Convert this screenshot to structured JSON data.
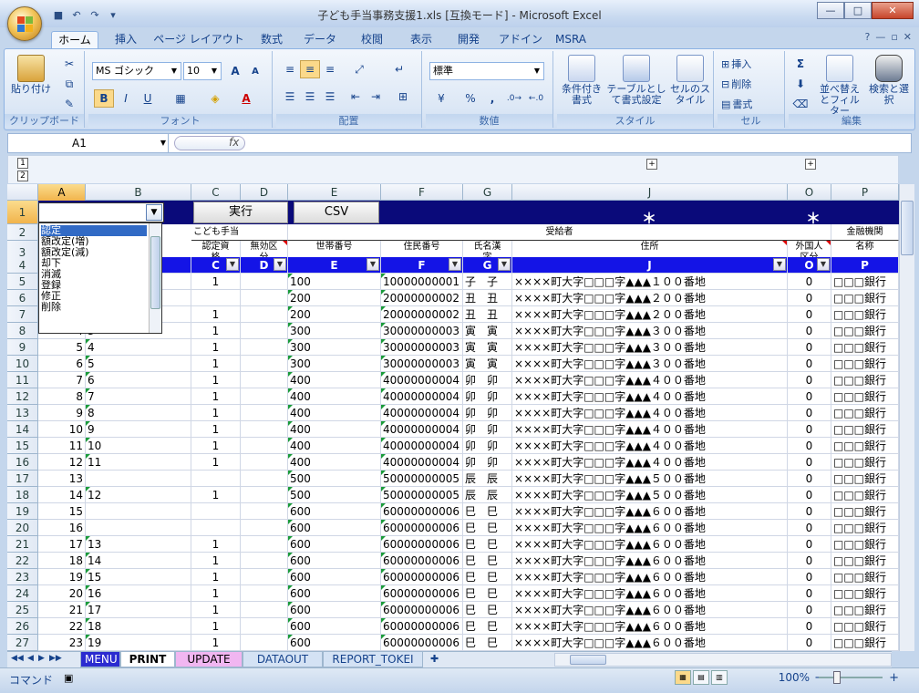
{
  "window": {
    "title": "子ども手当事務支援1.xls  [互換モード] - Microsoft Excel",
    "controls": {
      "minimize": "—",
      "maximize": "□",
      "close": "✕"
    }
  },
  "ribbon_tabs": [
    "ホーム",
    "挿入",
    "ページ レイアウト",
    "数式",
    "データ",
    "校閲",
    "表示",
    "開発",
    "アドイン",
    "MSRA"
  ],
  "ribbon_right": {
    "help": "?",
    "min": "—",
    "restore": "▫",
    "close": "✕"
  },
  "clipboard": {
    "paste": "貼り付け",
    "label": "クリップボード"
  },
  "font": {
    "name": "MS ゴシック",
    "size": "10",
    "label": "フォント",
    "grow": "A",
    "shrink": "A",
    "bold": "B",
    "italic": "I",
    "underline": "U",
    "font_color": "A"
  },
  "alignment": {
    "label": "配置"
  },
  "number": {
    "format": "標準",
    "label": "数値",
    "percent": "%",
    "comma": ","
  },
  "styles": {
    "conditional": "条件付き書式",
    "table": "テーブルとして書式設定",
    "cell": "セルのスタイル",
    "label": "スタイル"
  },
  "cells": {
    "insert": "挿入",
    "delete": "削除",
    "format": "書式",
    "label": "セル"
  },
  "editing": {
    "sum": "Σ",
    "sort": "並べ替えとフィルター",
    "find": "検索と選択",
    "label": "編集"
  },
  "formula_bar": {
    "name": "A1",
    "fx": "fx",
    "value": ""
  },
  "outline": {
    "level1": "1",
    "level2": "2",
    "plus": "+"
  },
  "columns": [
    "A",
    "B",
    "C",
    "D",
    "E",
    "F",
    "G",
    "J",
    "O",
    "P"
  ],
  "row1": {
    "exec_button": "実行",
    "csv_button": "CSV",
    "star": "＊"
  },
  "row2": {
    "child_allowance": "こども手当",
    "recipient": "受給者",
    "bank": "金融機関"
  },
  "row3": {
    "c": "認定資格",
    "d": "無効区分",
    "e": "世帯番号",
    "f": "住民番号",
    "g": "氏名漢字",
    "j": "住所",
    "o": "外国人区分",
    "p": "名称"
  },
  "row4": [
    "C",
    "D",
    "E",
    "F",
    "G",
    "J",
    "O",
    "P"
  ],
  "filter_arrow": "▼",
  "dropdown": {
    "arrow": "▼",
    "items": [
      "認定",
      "額改定(増)",
      "額改定(減)",
      "却下",
      "消滅",
      "登録",
      "修正",
      "削除"
    ]
  },
  "rows": [
    {
      "n": "5",
      "a": "",
      "b": "",
      "c": "1",
      "e": "100",
      "f": "10000000001",
      "g": "子　子",
      "j": "××××町大字□□□字▲▲▲１００番地",
      "o": "0",
      "p": "□□□銀行"
    },
    {
      "n": "6",
      "a": "",
      "b": "",
      "c": "",
      "e": "200",
      "f": "20000000002",
      "g": "丑　丑",
      "j": "××××町大字□□□字▲▲▲２００番地",
      "o": "0",
      "p": "□□□銀行"
    },
    {
      "n": "7",
      "a": "",
      "b": "",
      "c": "1",
      "e": "200",
      "f": "20000000002",
      "g": "丑　丑",
      "j": "××××町大字□□□字▲▲▲２００番地",
      "o": "0",
      "p": "□□□銀行"
    },
    {
      "n": "8",
      "a": "4",
      "b": "3",
      "c": "1",
      "e": "300",
      "f": "30000000003",
      "g": "寅　寅",
      "j": "××××町大字□□□字▲▲▲３００番地",
      "o": "0",
      "p": "□□□銀行"
    },
    {
      "n": "9",
      "a": "5",
      "b": "4",
      "c": "1",
      "e": "300",
      "f": "30000000003",
      "g": "寅　寅",
      "j": "××××町大字□□□字▲▲▲３００番地",
      "o": "0",
      "p": "□□□銀行"
    },
    {
      "n": "10",
      "a": "6",
      "b": "5",
      "c": "1",
      "e": "300",
      "f": "30000000003",
      "g": "寅　寅",
      "j": "××××町大字□□□字▲▲▲３００番地",
      "o": "0",
      "p": "□□□銀行"
    },
    {
      "n": "11",
      "a": "7",
      "b": "6",
      "c": "1",
      "e": "400",
      "f": "40000000004",
      "g": "卯　卯",
      "j": "××××町大字□□□字▲▲▲４００番地",
      "o": "0",
      "p": "□□□銀行"
    },
    {
      "n": "12",
      "a": "8",
      "b": "7",
      "c": "1",
      "e": "400",
      "f": "40000000004",
      "g": "卯　卯",
      "j": "××××町大字□□□字▲▲▲４００番地",
      "o": "0",
      "p": "□□□銀行"
    },
    {
      "n": "13",
      "a": "9",
      "b": "8",
      "c": "1",
      "e": "400",
      "f": "40000000004",
      "g": "卯　卯",
      "j": "××××町大字□□□字▲▲▲４００番地",
      "o": "0",
      "p": "□□□銀行"
    },
    {
      "n": "14",
      "a": "10",
      "b": "9",
      "c": "1",
      "e": "400",
      "f": "40000000004",
      "g": "卯　卯",
      "j": "××××町大字□□□字▲▲▲４００番地",
      "o": "0",
      "p": "□□□銀行"
    },
    {
      "n": "15",
      "a": "11",
      "b": "10",
      "c": "1",
      "e": "400",
      "f": "40000000004",
      "g": "卯　卯",
      "j": "××××町大字□□□字▲▲▲４００番地",
      "o": "0",
      "p": "□□□銀行"
    },
    {
      "n": "16",
      "a": "12",
      "b": "11",
      "c": "1",
      "e": "400",
      "f": "40000000004",
      "g": "卯　卯",
      "j": "××××町大字□□□字▲▲▲４００番地",
      "o": "0",
      "p": "□□□銀行"
    },
    {
      "n": "17",
      "a": "13",
      "b": "",
      "c": "",
      "e": "500",
      "f": "50000000005",
      "g": "辰　辰",
      "j": "××××町大字□□□字▲▲▲５００番地",
      "o": "0",
      "p": "□□□銀行"
    },
    {
      "n": "18",
      "a": "14",
      "b": "12",
      "c": "1",
      "e": "500",
      "f": "50000000005",
      "g": "辰　辰",
      "j": "××××町大字□□□字▲▲▲５００番地",
      "o": "0",
      "p": "□□□銀行"
    },
    {
      "n": "19",
      "a": "15",
      "b": "",
      "c": "",
      "e": "600",
      "f": "60000000006",
      "g": "巳　巳",
      "j": "××××町大字□□□字▲▲▲６００番地",
      "o": "0",
      "p": "□□□銀行"
    },
    {
      "n": "20",
      "a": "16",
      "b": "",
      "c": "",
      "e": "600",
      "f": "60000000006",
      "g": "巳　巳",
      "j": "××××町大字□□□字▲▲▲６００番地",
      "o": "0",
      "p": "□□□銀行"
    },
    {
      "n": "21",
      "a": "17",
      "b": "13",
      "c": "1",
      "e": "600",
      "f": "60000000006",
      "g": "巳　巳",
      "j": "××××町大字□□□字▲▲▲６００番地",
      "o": "0",
      "p": "□□□銀行"
    },
    {
      "n": "22",
      "a": "18",
      "b": "14",
      "c": "1",
      "e": "600",
      "f": "60000000006",
      "g": "巳　巳",
      "j": "××××町大字□□□字▲▲▲６００番地",
      "o": "0",
      "p": "□□□銀行"
    },
    {
      "n": "23",
      "a": "19",
      "b": "15",
      "c": "1",
      "e": "600",
      "f": "60000000006",
      "g": "巳　巳",
      "j": "××××町大字□□□字▲▲▲６００番地",
      "o": "0",
      "p": "□□□銀行"
    },
    {
      "n": "24",
      "a": "20",
      "b": "16",
      "c": "1",
      "e": "600",
      "f": "60000000006",
      "g": "巳　巳",
      "j": "××××町大字□□□字▲▲▲６００番地",
      "o": "0",
      "p": "□□□銀行"
    },
    {
      "n": "25",
      "a": "21",
      "b": "17",
      "c": "1",
      "e": "600",
      "f": "60000000006",
      "g": "巳　巳",
      "j": "××××町大字□□□字▲▲▲６００番地",
      "o": "0",
      "p": "□□□銀行"
    },
    {
      "n": "26",
      "a": "22",
      "b": "18",
      "c": "1",
      "e": "600",
      "f": "60000000006",
      "g": "巳　巳",
      "j": "××××町大字□□□字▲▲▲６００番地",
      "o": "0",
      "p": "□□□銀行"
    },
    {
      "n": "27",
      "a": "23",
      "b": "19",
      "c": "1",
      "e": "600",
      "f": "60000000006",
      "g": "巳　巳",
      "j": "××××町大字□□□字▲▲▲６００番地",
      "o": "0",
      "p": "□□□銀行"
    }
  ],
  "sheet_tabs": [
    "MENU",
    "PRINT",
    "UPDATE",
    "DATAOUT",
    "REPORT_TOKEI"
  ],
  "status": {
    "mode": "コマンド",
    "zoom": "100%",
    "minus": "−",
    "plus": "+"
  },
  "colors": {
    "navy": "#0a0a7a",
    "blue_header": "#1414e6",
    "accent": "#15428b"
  }
}
